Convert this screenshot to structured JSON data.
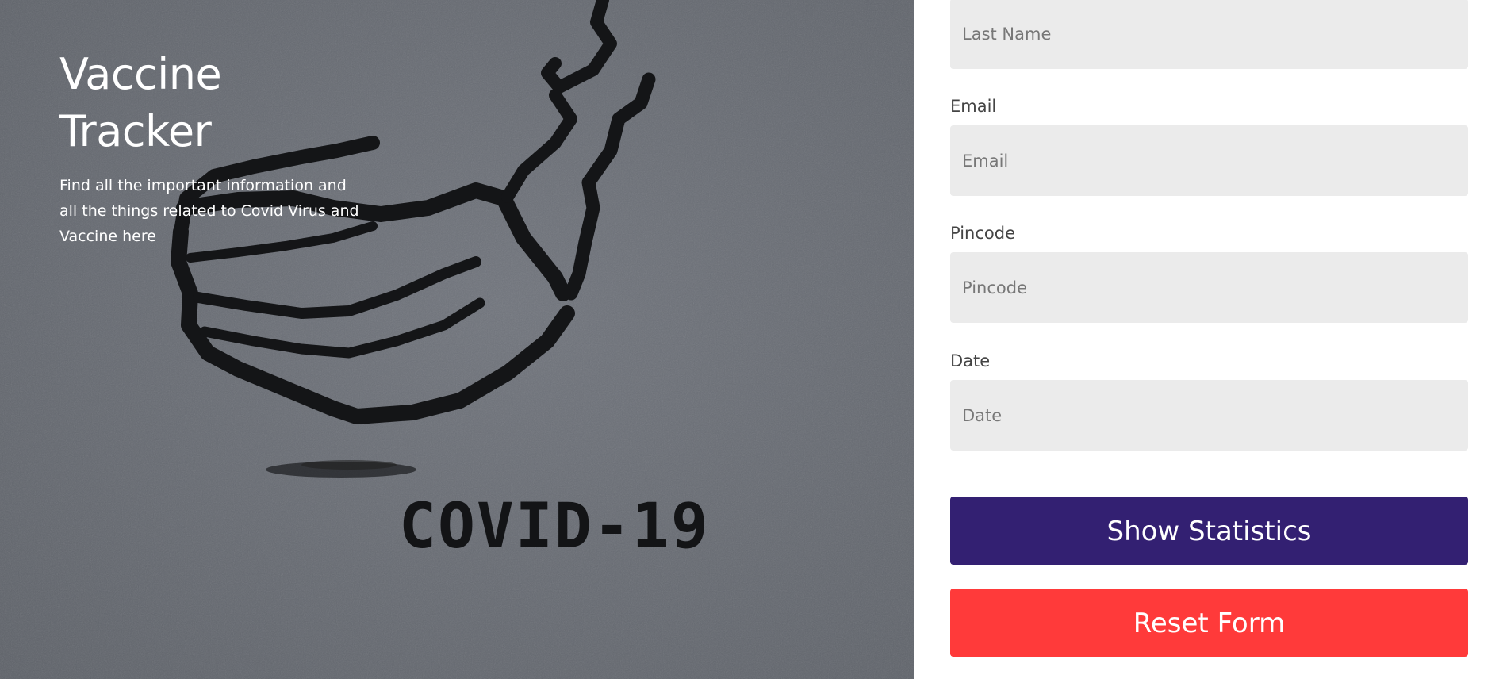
{
  "hero": {
    "title": "Vaccine Tracker",
    "description": "Find all the important information and all the things related to Covid Virus and Vaccine here",
    "stencil_text": "COVID-19"
  },
  "form": {
    "last_name": {
      "placeholder": "Last Name"
    },
    "email": {
      "label": "Email",
      "placeholder": "Email"
    },
    "pincode": {
      "label": "Pincode",
      "placeholder": "Pincode"
    },
    "date": {
      "label": "Date",
      "placeholder": "Date"
    },
    "show_statistics_label": "Show Statistics",
    "reset_form_label": "Reset Form"
  },
  "colors": {
    "primary_button": "#332072",
    "reset_button": "#ff3a3a",
    "input_background": "#ebebeb"
  }
}
